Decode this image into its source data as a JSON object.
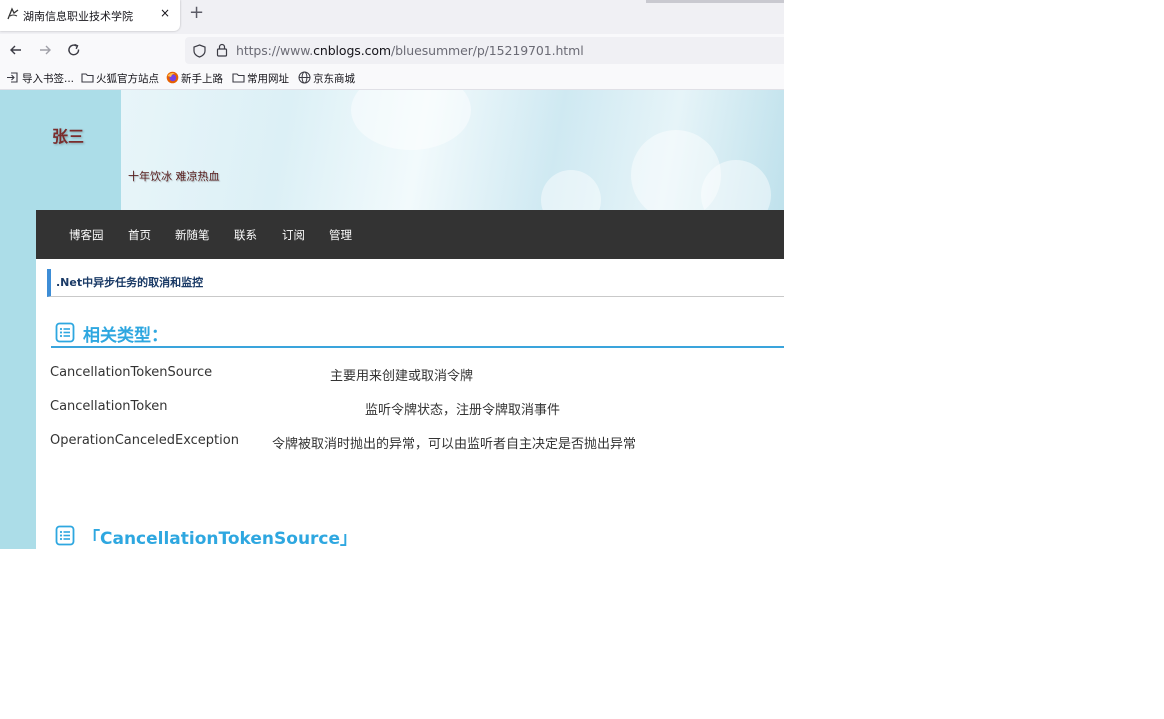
{
  "browser": {
    "tab_title": "湖南信息职业技术学院",
    "tab_close": "×",
    "new_tab": "+",
    "url_prefix": "https://www.",
    "url_domain": "cnblogs.com",
    "url_path": "/bluesummer/p/15219701.html",
    "bookmarks": [
      {
        "label": "导入书签...",
        "icon": "import-icon"
      },
      {
        "label": "火狐官方站点",
        "icon": "folder-icon"
      },
      {
        "label": "新手上路",
        "icon": "firefox-icon"
      },
      {
        "label": "常用网址",
        "icon": "folder-icon"
      },
      {
        "label": "京东商城",
        "icon": "globe-icon"
      }
    ]
  },
  "blog": {
    "title": "张三",
    "subtitle": "十年饮冰 难凉热血",
    "nav": [
      "博客园",
      "首页",
      "新随笔",
      "联系",
      "订阅",
      "管理"
    ]
  },
  "post": {
    "title": ".Net中异步任务的取消和监控",
    "section1": "相关类型：",
    "types": [
      {
        "name": "CancellationTokenSource",
        "desc": "主要用来创建或取消令牌"
      },
      {
        "name": "CancellationToken",
        "desc": "监听令牌状态，注册令牌取消事件"
      },
      {
        "name": "OperationCanceledException",
        "desc": "令牌被取消时抛出的异常，可以由监听者自主决定是否抛出异常"
      }
    ],
    "section2": "「CancellationTokenSource」"
  },
  "colors": {
    "page_bg": "#acdde8",
    "menu_bg": "#333333",
    "heading": "#2ea7e0",
    "title_accent": "#3d8dd6",
    "blog_title": "#7a2c2c"
  }
}
